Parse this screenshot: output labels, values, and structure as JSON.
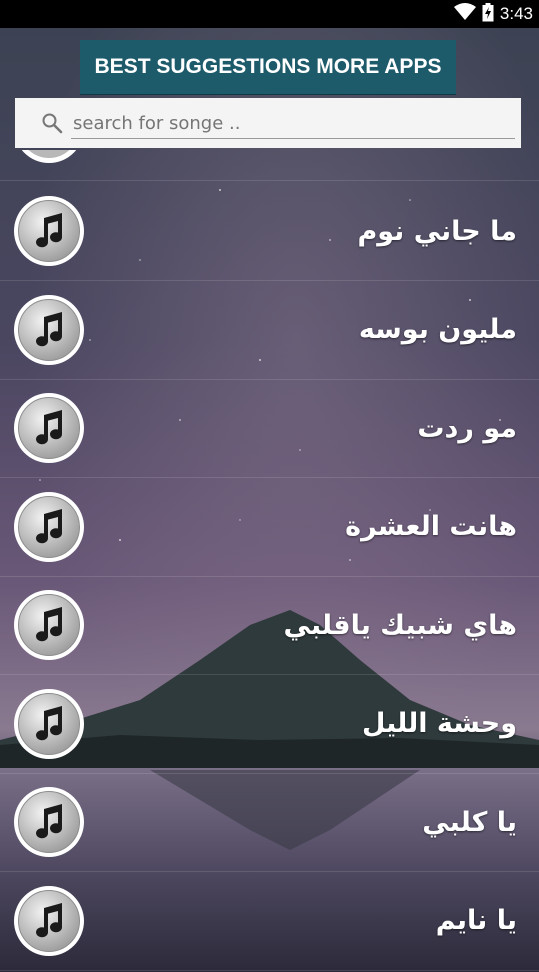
{
  "status_bar": {
    "time": "3:43"
  },
  "promo_button": {
    "label": "BEST SUGGESTIONS MORE APPS"
  },
  "search": {
    "placeholder": "search for songe .."
  },
  "songs": [
    {
      "title": "ما جاني نوم"
    },
    {
      "title": "مليون بوسه"
    },
    {
      "title": "مو ردت"
    },
    {
      "title": "هانت العشرة"
    },
    {
      "title": "هاي شبيك ياقلبي"
    },
    {
      "title": "وحشة الليل"
    },
    {
      "title": "يا كلبي"
    },
    {
      "title": "يا نايم"
    }
  ],
  "icons": {
    "status": [
      "wifi-icon",
      "battery-icon"
    ],
    "search": "search-icon",
    "song": "music-note-icon"
  },
  "colors": {
    "promo_bg": "#1d5a6a",
    "search_bg": "#f4f4f4",
    "status_bg": "#000000"
  }
}
